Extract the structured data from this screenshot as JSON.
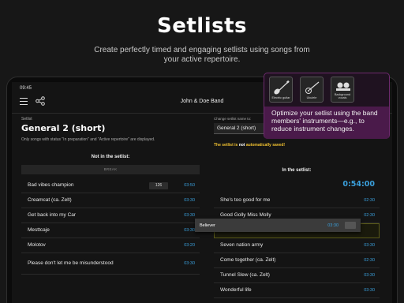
{
  "promo": {
    "title": "Setlists",
    "subtitle": "Create perfectly timed and engaging setlists using songs from your active repertoire."
  },
  "statusbar": {
    "time": "09:45"
  },
  "appbar": {
    "title": "John & Doe Band"
  },
  "left": {
    "label": "Setlist",
    "name": "General 2 (short)",
    "note": "Only songs with status \"In preparation\" and \"Active repertoire\" are displayed.",
    "not_in_heading": "Not in the setlist:",
    "break_label": "BREAK",
    "songs": [
      {
        "title": "Bad vibes champion",
        "bpm": "126",
        "duration": "03:50"
      },
      {
        "title": "Creamcat (ca. Zelt)",
        "bpm": "",
        "duration": "03:30"
      },
      {
        "title": "Get back into my Car",
        "bpm": "",
        "duration": "03:30"
      },
      {
        "title": "Mesttcaje",
        "bpm": "",
        "duration": "03:30"
      },
      {
        "title": "Molotov",
        "bpm": "",
        "duration": "03:20"
      },
      {
        "title": "Please don't let me be misunderstood",
        "bpm": "",
        "duration": "03:30"
      }
    ]
  },
  "right": {
    "change_label": "Change setlist name to:",
    "name_value": "General 2 (short)",
    "not_saved_prefix": "The setlist is ",
    "not_saved_word": "not",
    "not_saved_suffix": " automatically saved!",
    "in_heading": "In the setlist:",
    "total_time": "0:54:00",
    "songs_before": [
      {
        "title": "She's too good for me",
        "duration": "02:30"
      },
      {
        "title": "Good Golly Miss Molly",
        "duration": "02:30"
      }
    ],
    "songs_after": [
      {
        "title": "Seven nation army",
        "duration": "03:30"
      },
      {
        "title": "Come together (ca. Zelt)",
        "duration": "02:30"
      },
      {
        "title": "Tunnel Slew (ca. Zelt)",
        "duration": "03:30"
      },
      {
        "title": "Wonderful life",
        "duration": "03:30"
      }
    ],
    "dragging": {
      "title": "Believer",
      "duration": "03:30"
    }
  },
  "tooltip": {
    "instruments": [
      {
        "label": "Electric guitar",
        "icon": "electric-guitar-icon"
      },
      {
        "label": "Ukulele",
        "icon": "ukulele-icon"
      },
      {
        "label": "Background vocals",
        "icon": "background-vocals-icon"
      }
    ],
    "text": "Optimize your setlist using the band members' instruments—e.g., to reduce instrument changes."
  },
  "colors": {
    "accent_blue": "#3a9fdb",
    "warning_yellow": "#f2c230",
    "tooltip_purple": "#4a1a4a"
  }
}
